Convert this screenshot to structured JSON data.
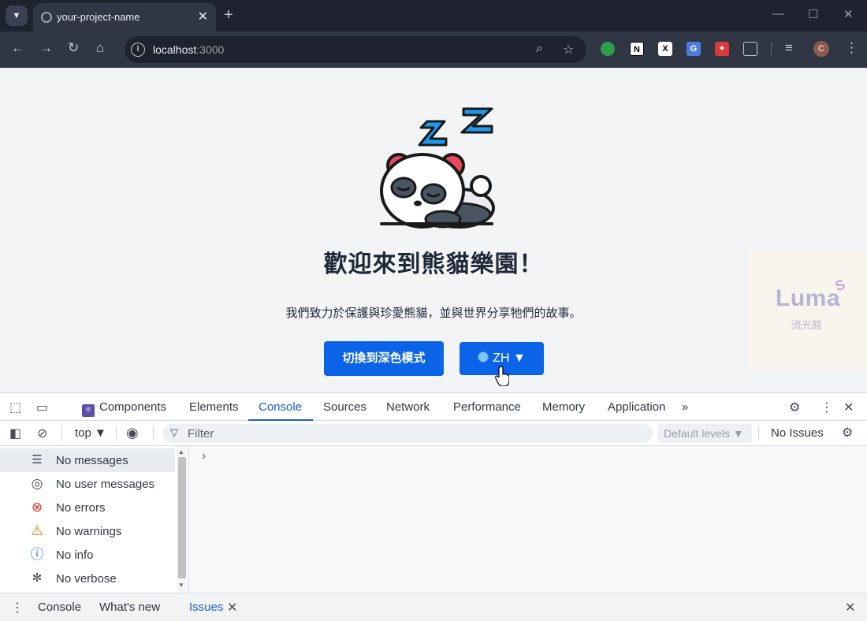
{
  "browser": {
    "tab_title": "your-project-name",
    "url_host": "localhost",
    "url_port": ":3000",
    "avatar_initial": "C"
  },
  "page": {
    "headline": "歡迎來到熊貓樂園！",
    "tagline": "我們致力於保護與珍愛熊貓，並與世界分享牠們的故事。",
    "dark_mode_button": "切換到深色模式",
    "language_button": "ZH ▼",
    "watermark_logo": "Luma",
    "watermark_sub": "流光館"
  },
  "devtools": {
    "tabs": [
      {
        "label": "Components"
      },
      {
        "label": "Elements"
      },
      {
        "label": "Console"
      },
      {
        "label": "Sources"
      },
      {
        "label": "Network"
      },
      {
        "label": "Performance"
      },
      {
        "label": "Memory"
      },
      {
        "label": "Application"
      }
    ],
    "more_tabs": "»",
    "context": "top ▼",
    "filter_placeholder": "Filter",
    "levels": "Default levels ▼",
    "issues": "No Issues",
    "sidebar": [
      {
        "label": "No messages",
        "icon": "list-icon"
      },
      {
        "label": "No user messages",
        "icon": "user-icon"
      },
      {
        "label": "No errors",
        "icon": "error-icon"
      },
      {
        "label": "No warnings",
        "icon": "warning-icon"
      },
      {
        "label": "No info",
        "icon": "info-icon"
      },
      {
        "label": "No verbose",
        "icon": "bug-icon"
      }
    ],
    "drawer_tabs": [
      {
        "label": "Console"
      },
      {
        "label": "What's new"
      },
      {
        "label": "Issues"
      }
    ]
  },
  "colors": {
    "primary_button": "#0b63e8",
    "devtools_active": "#1a5ec8",
    "page_background": "#f3f4f6"
  }
}
